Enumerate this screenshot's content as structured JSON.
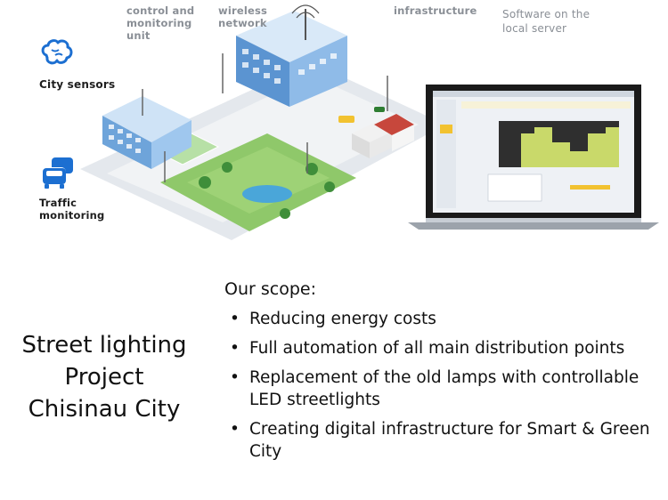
{
  "labels": {
    "control": "control and\nmonitoring\nunit",
    "wireless": "wireless\nnetwork",
    "infrastructure": "infrastructure",
    "software": "Software on the\nlocal server",
    "city_sensors": "City sensors",
    "traffic": "Traffic\nmonitoring"
  },
  "title": {
    "line1": "Street lighting",
    "line2": "Project",
    "line3": "Chisinau City"
  },
  "scope": {
    "heading": "Our scope:",
    "items": [
      "Reducing energy costs",
      "Full automation of all main distribution points",
      "Replacement of the old lamps with controllable LED streetlights",
      "Creating digital infrastructure for Smart & Green City"
    ],
    "bullet": "•"
  },
  "icons": {
    "brain": "brain-icon",
    "cars": "cars-icon",
    "laptop": "laptop-icon"
  },
  "colors": {
    "icon_blue": "#1c6fd1",
    "chart_fill": "#c9d96a",
    "grass": "#8fc86a"
  }
}
